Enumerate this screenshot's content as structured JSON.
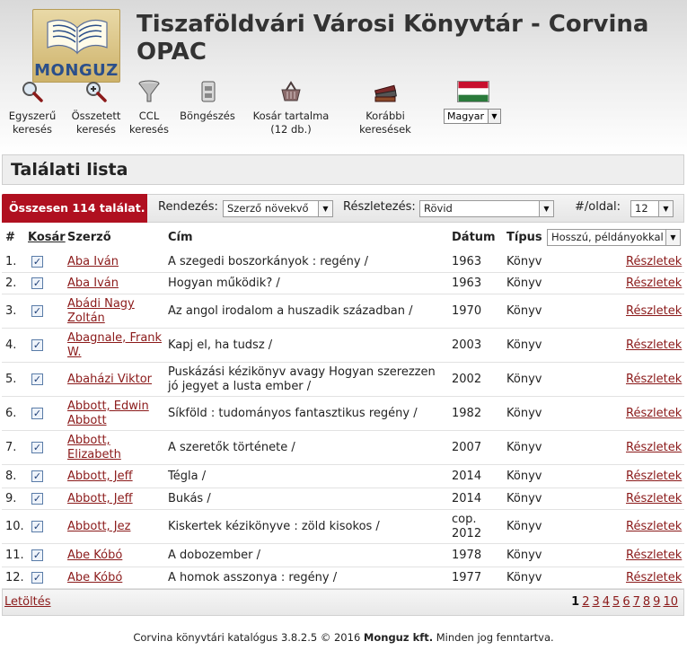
{
  "header": {
    "title": "Tiszaföldvári Városi Könyvtár - Corvina OPAC",
    "logo_text": "MONGUZ"
  },
  "nav": [
    {
      "label": "Egyszerű keresés",
      "icon": "magnifier-icon"
    },
    {
      "label": "Összetett keresés",
      "icon": "magnifier-plus-icon"
    },
    {
      "label": "CCL keresés",
      "icon": "funnel-icon"
    },
    {
      "label": "Böngészés",
      "icon": "index-drawer-icon"
    },
    {
      "label": "Kosár tartalma (12 db.)",
      "icon": "basket-icon"
    },
    {
      "label": "Korábbi keresések",
      "icon": "books-icon"
    }
  ],
  "language": {
    "selected": "Magyar",
    "flag_colors": [
      "#c8102e",
      "#ffffff",
      "#2a7a3b"
    ]
  },
  "section_title": "Találati lista",
  "controls": {
    "hits": "Összesen 114 találat.",
    "sort_label": "Rendezés:",
    "sort_value": "Szerző növekvő",
    "detail_label": "Részletezés:",
    "detail_value": "Rövid",
    "perpage_label": "#/oldal:",
    "perpage_value": "12"
  },
  "table": {
    "headers": {
      "num": "#",
      "basket": "Kosár",
      "author": "Szerző",
      "title": "Cím",
      "date": "Dátum",
      "type": "Típus",
      "display_select": "Hosszú, példányokkal"
    },
    "rows": [
      {
        "num": "1.",
        "author": "Aba Iván",
        "title": "A szegedi boszorkányok : regény /",
        "date": "1963",
        "type": "Könyv",
        "details": "Részletek"
      },
      {
        "num": "2.",
        "author": "Aba Iván",
        "title": "Hogyan működik? /",
        "date": "1963",
        "type": "Könyv",
        "details": "Részletek"
      },
      {
        "num": "3.",
        "author": "Abádi Nagy Zoltán",
        "title": "Az angol irodalom a huszadik században /",
        "date": "1970",
        "type": "Könyv",
        "details": "Részletek"
      },
      {
        "num": "4.",
        "author": "Abagnale, Frank W.",
        "title": "Kapj el, ha tudsz /",
        "date": "2003",
        "type": "Könyv",
        "details": "Részletek"
      },
      {
        "num": "5.",
        "author": "Abaházi Viktor",
        "title": "Puskázási kézikönyv avagy Hogyan szerezzen jó jegyet a lusta ember /",
        "date": "2002",
        "type": "Könyv",
        "details": "Részletek"
      },
      {
        "num": "6.",
        "author": "Abbott, Edwin Abbott",
        "title": "Síkföld : tudományos fantasztikus regény /",
        "date": "1982",
        "type": "Könyv",
        "details": "Részletek"
      },
      {
        "num": "7.",
        "author": "Abbott, Elizabeth",
        "title": "A szeretők története /",
        "date": "2007",
        "type": "Könyv",
        "details": "Részletek"
      },
      {
        "num": "8.",
        "author": "Abbott, Jeff",
        "title": "Tégla /",
        "date": "2014",
        "type": "Könyv",
        "details": "Részletek"
      },
      {
        "num": "9.",
        "author": "Abbott, Jeff",
        "title": "Bukás /",
        "date": "2014",
        "type": "Könyv",
        "details": "Részletek"
      },
      {
        "num": "10.",
        "author": "Abbott, Jez",
        "title": "Kiskertek kézikönyve : zöld kisokos /",
        "date": "cop. 2012",
        "type": "Könyv",
        "details": "Részletek"
      },
      {
        "num": "11.",
        "author": "Abe Kóbó",
        "title": "A dobozember /",
        "date": "1978",
        "type": "Könyv",
        "details": "Részletek"
      },
      {
        "num": "12.",
        "author": "Abe Kóbó",
        "title": "A homok asszonya : regény /",
        "date": "1977",
        "type": "Könyv",
        "details": "Részletek"
      }
    ]
  },
  "footer": {
    "download": "Letöltés",
    "pages": [
      "1",
      "2",
      "3",
      "4",
      "5",
      "6",
      "7",
      "8",
      "9",
      "10"
    ],
    "current_page": "1",
    "copyright_pre": "Corvina könyvtári katalógus 3.8.2.5 © 2016 ",
    "copyright_brand": "Monguz kft.",
    "copyright_post": " Minden jog fenntartva."
  }
}
